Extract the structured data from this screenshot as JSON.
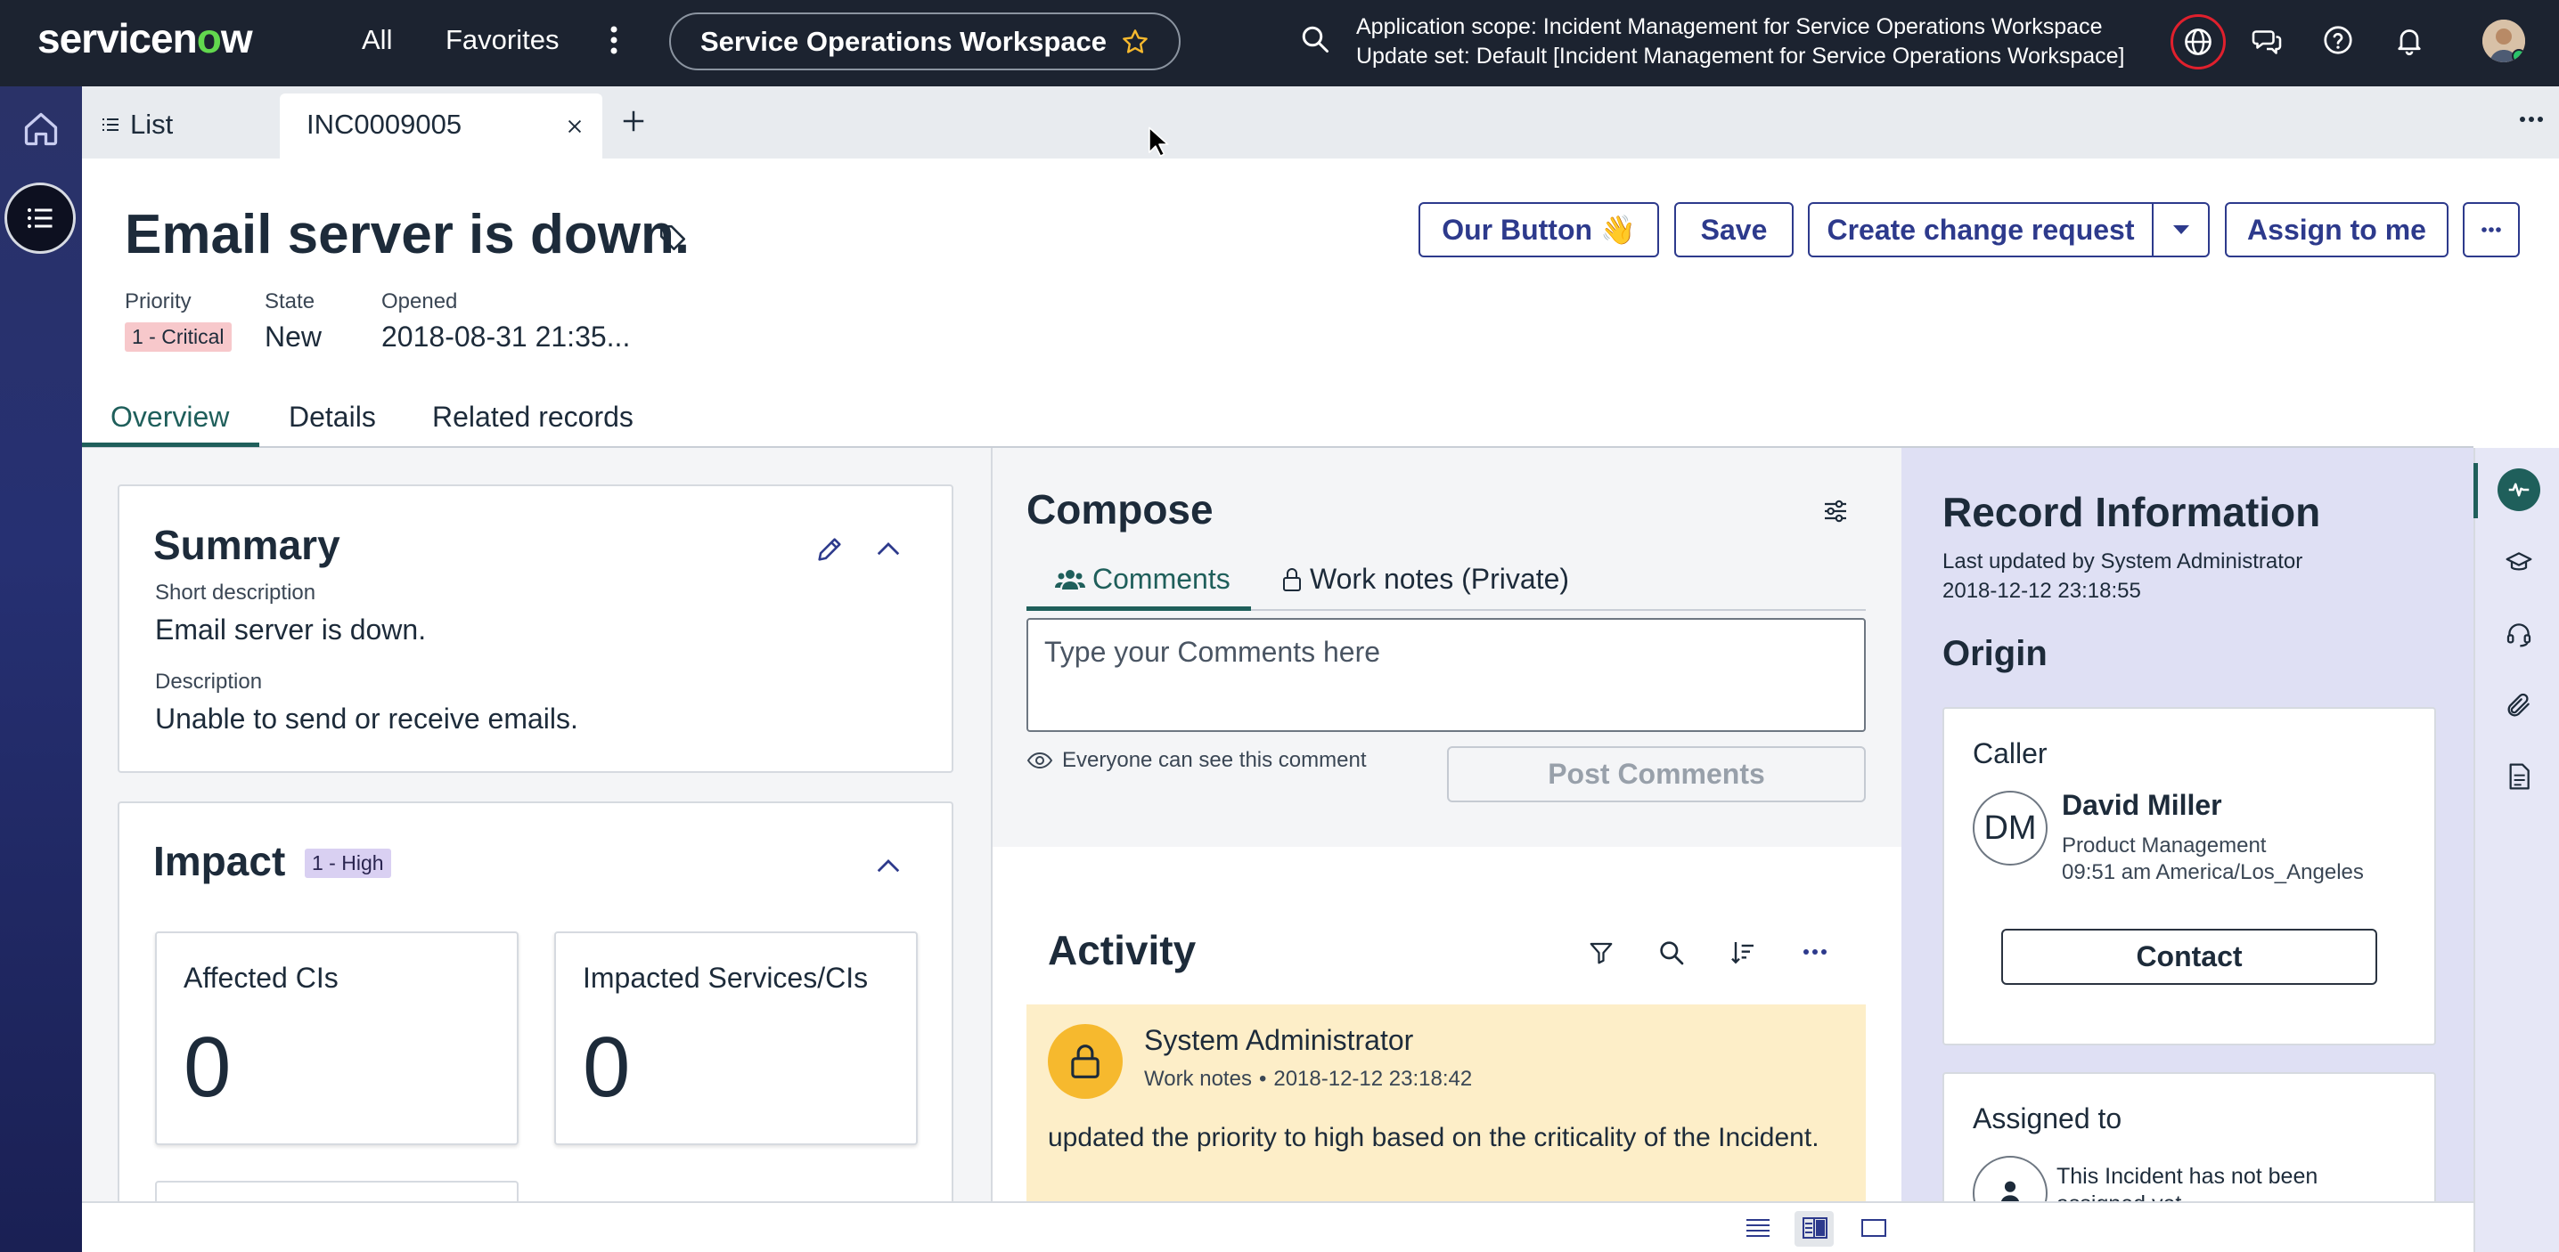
{
  "topbar": {
    "logo_left": "servicen",
    "logo_o": "o",
    "logo_right": "w",
    "nav_all": "All",
    "nav_favorites": "Favorites",
    "workspace": "Service Operations Workspace",
    "scope_line1": "Application scope: Incident Management for Service Operations Workspace",
    "scope_line2": "Update set: Default [Incident Management for Service Operations Workspace]"
  },
  "tabs": {
    "list_label": "List",
    "record_tab": "INC0009005"
  },
  "record": {
    "title": "Email server is down.",
    "priority_label": "Priority",
    "priority_value": "1 - Critical",
    "state_label": "State",
    "state_value": "New",
    "opened_label": "Opened",
    "opened_value": "2018-08-31 21:35..."
  },
  "actions": {
    "our_button": "Our Button 👋",
    "save": "Save",
    "create_change": "Create change request",
    "assign_to_me": "Assign to me"
  },
  "detail_tabs": [
    "Overview",
    "Details",
    "Related records"
  ],
  "summary": {
    "title": "Summary",
    "short_desc_label": "Short description",
    "short_desc": "Email server is down.",
    "desc_label": "Description",
    "desc": "Unable to send or receive emails."
  },
  "impact": {
    "title": "Impact",
    "badge": "1 - High",
    "tiles": [
      {
        "label": "Affected CIs",
        "value": "0"
      },
      {
        "label": "Impacted Services/CIs",
        "value": "0"
      }
    ]
  },
  "compose": {
    "title": "Compose",
    "tab_comments": "Comments",
    "tab_worknotes": "Work notes (Private)",
    "placeholder": "Type your Comments here",
    "visibility": "Everyone can see this comment",
    "post": "Post Comments"
  },
  "activity": {
    "title": "Activity",
    "entry": {
      "author": "System Administrator",
      "type": "Work notes",
      "time": "2018-12-12 23:18:42",
      "text": "updated the priority to high based on the criticality of the Incident."
    }
  },
  "record_info": {
    "title": "Record Information",
    "updated_by": "Last updated by System Administrator",
    "updated_at": "2018-12-12 23:18:55",
    "origin": "Origin",
    "caller_label": "Caller",
    "caller_initials": "DM",
    "caller_name": "David Miller",
    "caller_dept": "Product Management",
    "caller_time": "09:51 am America/Los_Angeles",
    "contact": "Contact",
    "assigned_label": "Assigned to",
    "assigned_text": "This Incident has not been assigned yet"
  },
  "colors": {
    "topbar": "#1c2330",
    "accent": "#2d3a8c",
    "active_tab": "#1f5f5b",
    "critical_badge": "#f7c8cb",
    "high_badge": "#d9d0f2",
    "activity_bg": "#fdeec8"
  }
}
